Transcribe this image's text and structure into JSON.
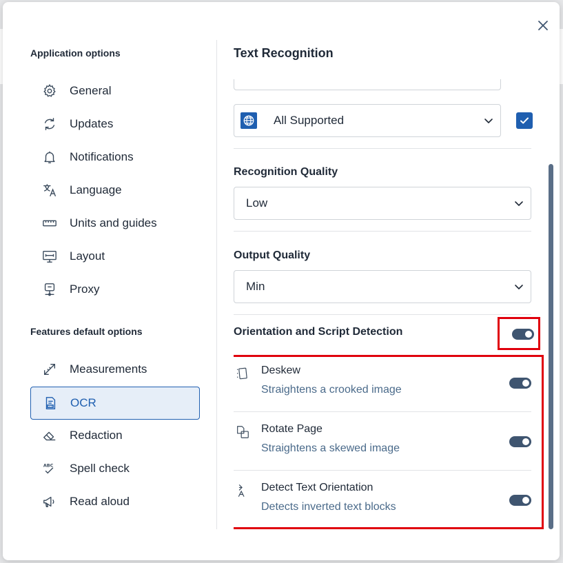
{
  "dialog": {
    "close_label": "×"
  },
  "sidebar": {
    "app_section_title": "Application options",
    "app_items": [
      {
        "label": "General",
        "icon": "gear-icon"
      },
      {
        "label": "Updates",
        "icon": "refresh-icon"
      },
      {
        "label": "Notifications",
        "icon": "bell-icon"
      },
      {
        "label": "Language",
        "icon": "translate-icon"
      },
      {
        "label": "Units and guides",
        "icon": "ruler-icon"
      },
      {
        "label": "Layout",
        "icon": "layout-icon"
      },
      {
        "label": "Proxy",
        "icon": "network-icon"
      }
    ],
    "features_section_title": "Features default options",
    "feature_items": [
      {
        "label": "Measurements",
        "icon": "measure-icon"
      },
      {
        "label": "OCR",
        "icon": "ocr-icon",
        "active": true
      },
      {
        "label": "Redaction",
        "icon": "eraser-icon"
      },
      {
        "label": "Spell check",
        "icon": "spellcheck-icon"
      },
      {
        "label": "Read aloud",
        "icon": "megaphone-icon"
      }
    ]
  },
  "main": {
    "title": "Text Recognition",
    "language_select_value": "All Supported",
    "language_checkbox_checked": true,
    "recognition_quality_label": "Recognition Quality",
    "recognition_quality_value": "Low",
    "output_quality_label": "Output Quality",
    "output_quality_value": "Min",
    "ods_label": "Orientation and Script Detection",
    "ods_enabled": true,
    "sub_options": [
      {
        "title": "Deskew",
        "desc": "Straightens a crooked image",
        "enabled": true,
        "icon": "deskew-icon"
      },
      {
        "title": "Rotate Page",
        "desc": "Straightens a skewed image",
        "enabled": true,
        "icon": "rotate-page-icon"
      },
      {
        "title": "Detect Text Orientation",
        "desc": "Detects inverted text blocks",
        "enabled": true,
        "icon": "text-orientation-icon"
      }
    ]
  },
  "colors": {
    "accent": "#1f5fb0",
    "toggle_on": "#3f5570",
    "highlight": "#e0000c",
    "description_text": "#4a6a8a"
  }
}
